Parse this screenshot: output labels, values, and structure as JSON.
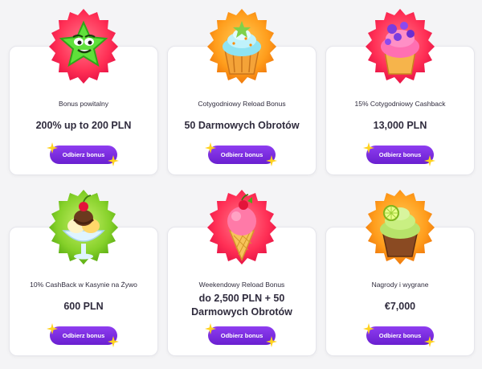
{
  "colors": {
    "button": "#7b2ee5",
    "badge_red": "#ff3b5c",
    "badge_orange": "#ff9a1f",
    "badge_green": "#8bd12a",
    "spark_yellow": "#ffd21f"
  },
  "cards": [
    {
      "subtitle": "Bonus powitalny",
      "amount": "200% up to 200 PLN",
      "button": "Odbierz bonus",
      "icon": "star-character-icon"
    },
    {
      "subtitle": "Cotygodniowy Reload Bonus",
      "amount": "50 Darmowych Obrotów",
      "button": "Odbierz bonus",
      "icon": "cupcake-icon"
    },
    {
      "subtitle": "15% Cotygodniowy Cashback",
      "amount": "13,000 PLN",
      "button": "Odbierz bonus",
      "icon": "berry-cupcake-icon"
    },
    {
      "subtitle": "10% CashBack w Kasynie na Żywo",
      "amount": "600 PLN",
      "button": "Odbierz bonus",
      "icon": "ice-cream-sundae-icon"
    },
    {
      "subtitle": "Weekendowy Reload Bonus",
      "amount_line1": "do 2,500 PLN + 50",
      "amount_line2": "Darmowych Obrotów",
      "button": "Odbierz bonus",
      "icon": "ice-cream-cone-icon"
    },
    {
      "subtitle": "Nagrody i wygrane",
      "amount": "€7,000",
      "button": "Odbierz bonus",
      "icon": "lime-cupcake-icon"
    }
  ]
}
